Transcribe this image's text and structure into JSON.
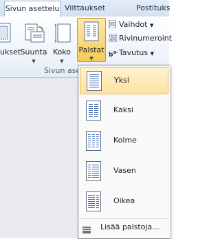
{
  "ribbon": {
    "tabs": [
      "Sivun asettelu",
      "Viittaukset",
      "Postituks"
    ],
    "buttons": {
      "margins": "ukset",
      "orientation": "Suunta",
      "size": "Koko",
      "columns": "Palstat"
    },
    "small_buttons": {
      "breaks": "Vaihdot",
      "line_numbers": "Rivinumeroint",
      "hyphenation": "Tavutus"
    },
    "group_label": "Sivun ase"
  },
  "menu": {
    "items": [
      {
        "label": "Yksi",
        "columns": 1,
        "highlighted": true
      },
      {
        "label": "Kaksi",
        "columns": 2,
        "highlighted": false
      },
      {
        "label": "Kolme",
        "columns": 3,
        "highlighted": false
      },
      {
        "label": "Vasen",
        "columns": "left",
        "highlighted": false
      },
      {
        "label": "Oikea",
        "columns": "right",
        "highlighted": false
      }
    ],
    "more": "Lisää palstoja..."
  }
}
